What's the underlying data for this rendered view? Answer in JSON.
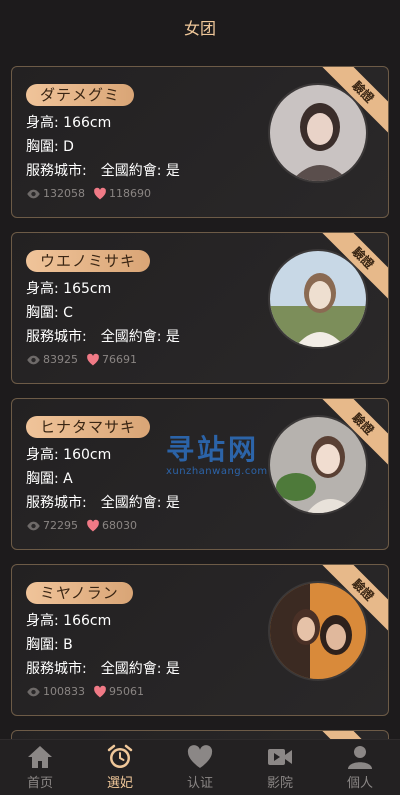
{
  "header": {
    "title": "女团"
  },
  "cards": [
    {
      "name": "ダテメグミ",
      "height": "身高: 166cm",
      "bust": "胸圍: D",
      "city_label": "服務城市:",
      "city_value": "全國約會: 是",
      "views": "132058",
      "likes": "118690",
      "ribbon": "驗證",
      "avatar_colors": [
        "#c9c3c2",
        "#5a4e4c",
        "#e9d3c8"
      ]
    },
    {
      "name": "ウエノミサキ",
      "height": "身高: 165cm",
      "bust": "胸圍: C",
      "city_label": "服務城市:",
      "city_value": "全國約會: 是",
      "views": "83925",
      "likes": "76691",
      "ribbon": "驗證",
      "avatar_colors": [
        "#c8d8e6",
        "#eedfd0",
        "#7c8e5a"
      ]
    },
    {
      "name": "ヒナタマサキ",
      "height": "身高: 160cm",
      "bust": "胸圍: A",
      "city_label": "服務城市:",
      "city_value": "全國約會: 是",
      "views": "72295",
      "likes": "68030",
      "ribbon": "驗證",
      "avatar_colors": [
        "#b6b2ae",
        "#f1ddd0",
        "#4e7a3a"
      ]
    },
    {
      "name": "ミヤノラン",
      "height": "身高: 166cm",
      "bust": "胸圍: B",
      "city_label": "服務城市:",
      "city_value": "全國約會: 是",
      "views": "100833",
      "likes": "95061",
      "ribbon": "驗證",
      "avatar_colors": [
        "#d98a3a",
        "#3b2a22",
        "#e6c2a8"
      ]
    }
  ],
  "watermark": {
    "main": "寻站网",
    "sub": "xunzhanwang.com"
  },
  "tabs": [
    {
      "label": "首页",
      "icon": "home-icon",
      "active": false
    },
    {
      "label": "選妃",
      "icon": "alarm-clock-icon",
      "active": true
    },
    {
      "label": "认证",
      "icon": "heart-icon",
      "active": false
    },
    {
      "label": "影院",
      "icon": "video-camera-icon",
      "active": false
    },
    {
      "label": "個人",
      "icon": "user-icon",
      "active": false
    }
  ],
  "colors": {
    "accent": "#f0c89a",
    "like": "#f07a86",
    "card_border": "#6d5b47"
  }
}
